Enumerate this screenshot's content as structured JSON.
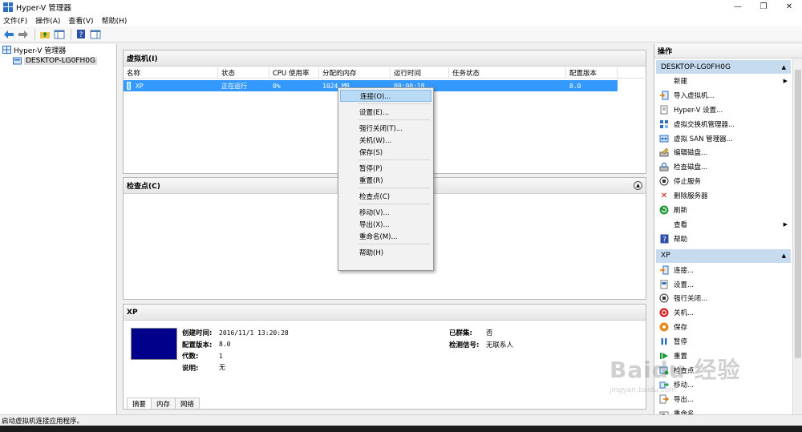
{
  "window": {
    "title": "Hyper-V 管理器",
    "minimize": "—",
    "maximize": "❐",
    "close": "✕"
  },
  "menu": [
    "文件(F)",
    "操作(A)",
    "查看(V)",
    "帮助(H)"
  ],
  "tree": {
    "root": "Hyper-V 管理器",
    "server": "DESKTOP-LG0FH0G"
  },
  "vm_panel": {
    "title": "虚拟机(I)",
    "columns": [
      "名称",
      "状态",
      "CPU 使用率",
      "分配的内存",
      "运行时间",
      "任务状态",
      "配置版本"
    ],
    "row": {
      "name": "XP",
      "state": "正在运行",
      "cpu": "0%",
      "memory": "1024 MB",
      "uptime": "00:00:18",
      "task": "",
      "version": "8.0"
    }
  },
  "checkpoint_panel": {
    "title": "检查点(C)"
  },
  "summary_panel": {
    "title": "XP",
    "left": [
      {
        "k": "创建时间:",
        "v": "2016/11/1 13:20:28"
      },
      {
        "k": "配置版本:",
        "v": "8.0"
      },
      {
        "k": "代数:",
        "v": "1"
      },
      {
        "k": "说明:",
        "v": "无"
      }
    ],
    "right": [
      {
        "k": "已群集:",
        "v": "否"
      },
      {
        "k": "检测信号:",
        "v": "无联系人"
      }
    ],
    "tabs": [
      "摘要",
      "内存",
      "网络"
    ]
  },
  "context_menu": [
    "连接(O)...",
    "设置(E)...",
    "强行关闭(T)...",
    "关机(W)...",
    "保存(S)",
    "暂停(P)",
    "重置(R)",
    "检查点(C)",
    "移动(V)...",
    "导出(X)...",
    "重命名(M)...",
    "帮助(H)"
  ],
  "actions": {
    "title": "操作",
    "server_group": "DESKTOP-LG0FH0G",
    "server_items": [
      "新建",
      "导入虚拟机...",
      "Hyper-V 设置...",
      "虚拟交换机管理器...",
      "虚拟 SAN 管理器...",
      "编辑磁盘...",
      "检查磁盘...",
      "停止服务",
      "删除服务器",
      "刷新",
      "查看",
      "帮助"
    ],
    "vm_group": "XP",
    "vm_items": [
      "连接...",
      "设置...",
      "强行关闭...",
      "关机...",
      "保存",
      "暂停",
      "重置",
      "检查点",
      "移动...",
      "导出...",
      "重命名..."
    ]
  },
  "status": "启动虚拟机连接应用程序。",
  "watermark": {
    "brand": "Baidu 经验",
    "url": "jingyan.baidu.com"
  },
  "colors": {
    "selection": "#3399ff",
    "menu_highlight": "#b9dbf6",
    "group_header": "#c7dbef",
    "vm_thumb": "#00008b"
  }
}
